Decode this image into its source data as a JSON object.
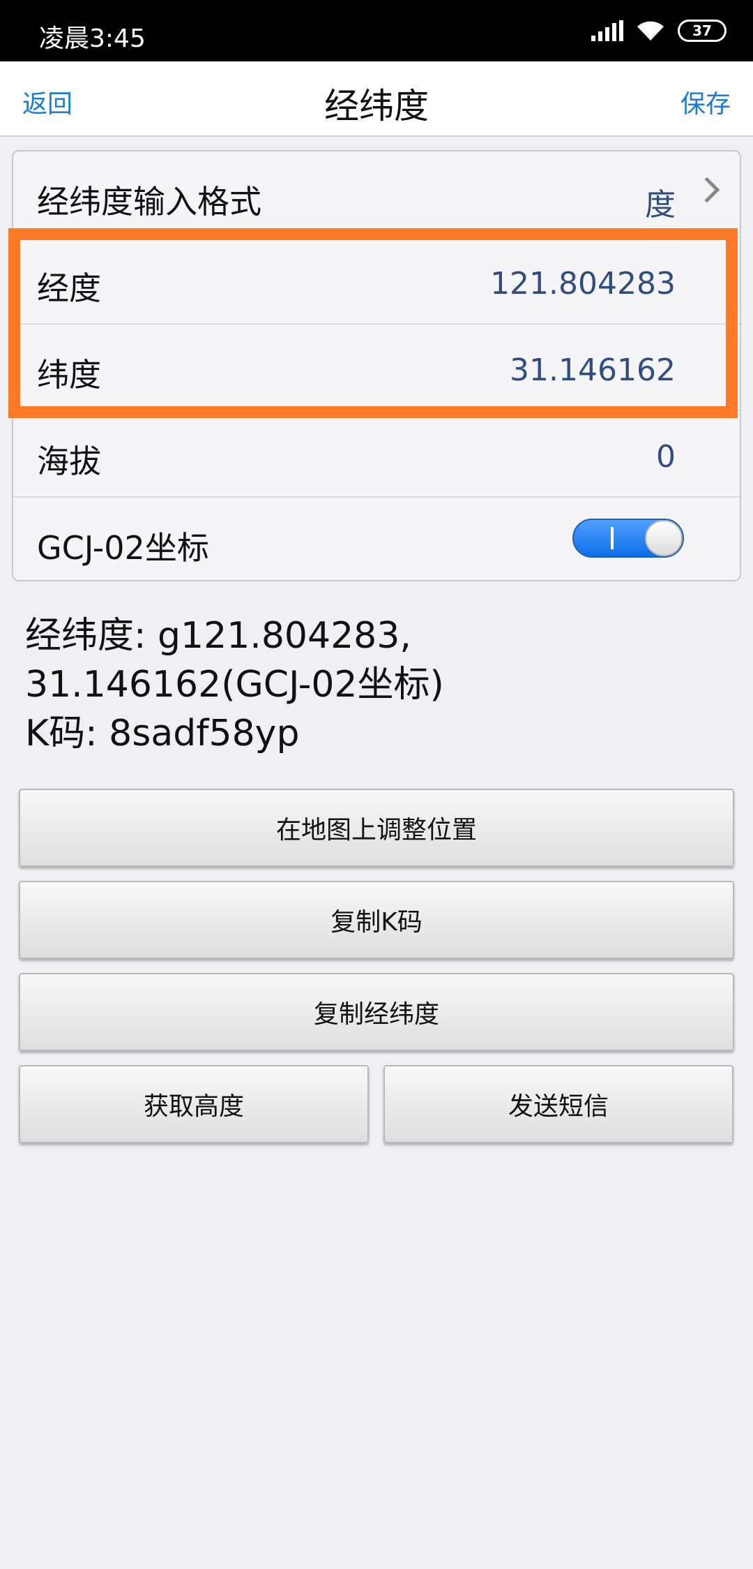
{
  "status_bar": {
    "time": "凌晨3:45",
    "battery": "37"
  },
  "nav": {
    "back": "返回",
    "title": "经纬度",
    "save": "保存"
  },
  "settings": {
    "format": {
      "label": "经纬度输入格式",
      "value": "度"
    },
    "longitude": {
      "label": "经度",
      "value": "121.804283"
    },
    "latitude": {
      "label": "纬度",
      "value": "31.146162"
    },
    "altitude": {
      "label": "海拔",
      "value": "0"
    },
    "gcj": {
      "label": "GCJ-02坐标",
      "enabled": true
    }
  },
  "summary": {
    "line1": "经纬度: g121.804283,",
    "line2": "31.146162(GCJ-02坐标)",
    "line3": "K码: 8sadf58yp"
  },
  "buttons": {
    "adjust_on_map": "在地图上调整位置",
    "copy_k_code": "复制K码",
    "copy_latlng": "复制经纬度",
    "get_altitude": "获取高度",
    "send_sms": "发送短信"
  },
  "colors": {
    "highlight": "#ff7a26",
    "link": "#1d7bd4",
    "toggle_on": "#1f7ff0"
  }
}
